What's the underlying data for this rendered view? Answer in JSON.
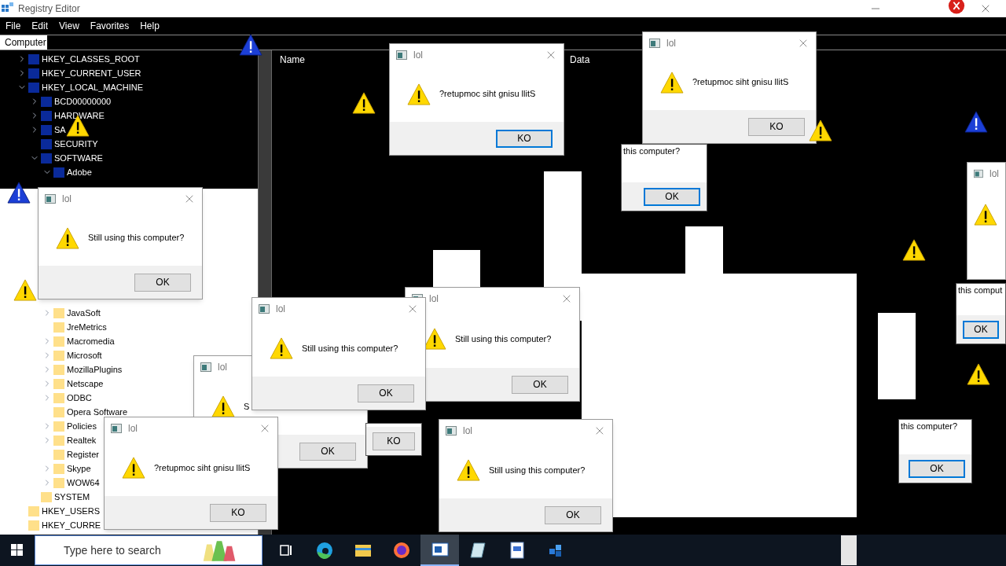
{
  "window": {
    "title": "Registry Editor"
  },
  "menu": [
    "File",
    "Edit",
    "View",
    "Favorites",
    "Help"
  ],
  "address": "Computer",
  "columns": [
    "Name",
    "Data"
  ],
  "tree": [
    {
      "label": "HKEY_CLASSES_ROOT",
      "expanded": false
    },
    {
      "label": "HKEY_CURRENT_USER",
      "expanded": false
    },
    {
      "label": "HKEY_LOCAL_MACHINE",
      "expanded": true,
      "children": [
        {
          "label": "BCD00000000",
          "expanded": false
        },
        {
          "label": "HARDWARE",
          "expanded": false
        },
        {
          "label": "SA",
          "expanded": false
        },
        {
          "label": "SECURITY"
        },
        {
          "label": "SOFTWARE",
          "expanded": true,
          "children": [
            {
              "label": "Adobe",
              "expanded": true
            },
            {
              "label": "JavaSoft",
              "expanded": false
            },
            {
              "label": "JreMetrics"
            },
            {
              "label": "Macromedia",
              "expanded": false
            },
            {
              "label": "Microsoft",
              "expanded": false
            },
            {
              "label": "MozillaPlugins",
              "expanded": false
            },
            {
              "label": "Netscape",
              "expanded": false
            },
            {
              "label": "ODBC",
              "expanded": false
            },
            {
              "label": "Opera Software"
            },
            {
              "label": "Policies",
              "expanded": false
            },
            {
              "label": "Realtek",
              "expanded": false
            },
            {
              "label": "Register"
            },
            {
              "label": "Skype",
              "expanded": false
            },
            {
              "label": "WOW64",
              "expanded": false
            }
          ]
        },
        {
          "label": "SYSTEM"
        }
      ]
    },
    {
      "label": "HKEY_USERS"
    },
    {
      "label": "HKEY_CURRE"
    }
  ],
  "dialogs": [
    {
      "kind": "full",
      "title": "lol",
      "message": "?retupmoc siht gnisu llitS",
      "button": "KO",
      "focused": true
    },
    {
      "kind": "full",
      "title": "lol",
      "message": "?retupmoc siht gnisu llitS",
      "button": "KO",
      "focused": false
    },
    {
      "kind": "fragment",
      "message": "this computer?",
      "button": "OK",
      "focused": true
    },
    {
      "kind": "full",
      "title": "lol",
      "message": "Still using this computer?",
      "button": "OK",
      "focused": false
    },
    {
      "kind": "full",
      "title": "lol",
      "message": "Still using this computer?",
      "button": "OK",
      "focused": false
    },
    {
      "kind": "full",
      "title": "lol",
      "message": "S",
      "button": "OK",
      "focused": false
    },
    {
      "kind": "fragment",
      "button": "KO",
      "focused": false
    },
    {
      "kind": "full",
      "title": "lol",
      "message": "Still using this computer?",
      "button": "OK",
      "focused": false
    },
    {
      "kind": "full",
      "title": "lol",
      "message": "?retupmoc siht gnisu llitS",
      "button": "KO",
      "focused": false
    },
    {
      "kind": "full",
      "title": "lol",
      "message": "Still using this computer?",
      "button": "OK",
      "focused": false
    },
    {
      "kind": "fragment",
      "message": "this comput",
      "button": "OK",
      "focused": true
    },
    {
      "kind": "fragment",
      "message": "this computer?",
      "button": "OK",
      "focused": true
    },
    {
      "kind": "title_only",
      "title": "lol"
    }
  ],
  "taskbar": {
    "search_placeholder": "Type here to search",
    "apps": [
      {
        "kind": "taskview",
        "selected": false
      },
      {
        "kind": "browser",
        "selected": false
      },
      {
        "kind": "folder",
        "selected": false
      },
      {
        "kind": "firefox",
        "selected": false
      },
      {
        "kind": "window",
        "selected": true
      },
      {
        "kind": "notepad",
        "selected": false
      },
      {
        "kind": "document",
        "selected": false
      },
      {
        "kind": "cubes",
        "selected": false
      }
    ]
  }
}
